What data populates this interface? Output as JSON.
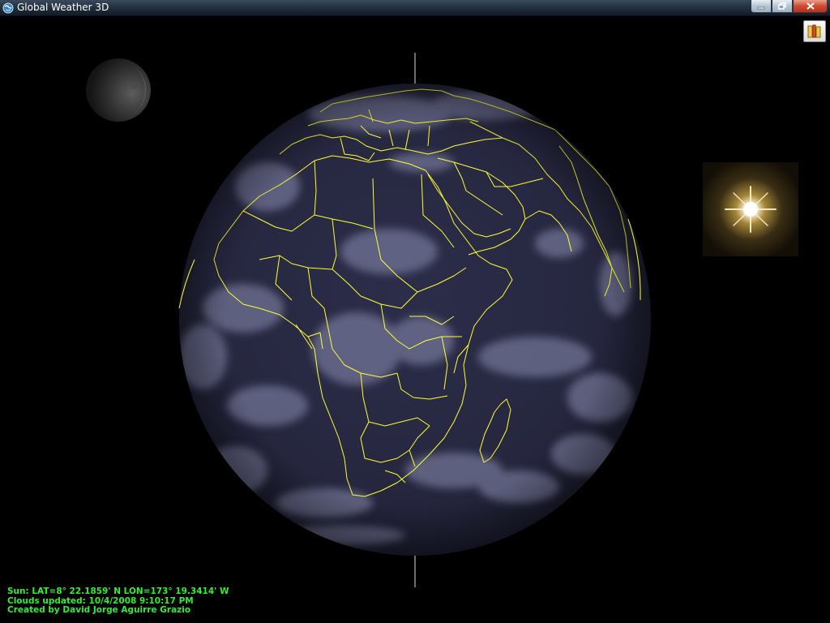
{
  "window": {
    "title": "Global Weather 3D"
  },
  "icons": {
    "app": "globe-icon",
    "minimize": "minimize-icon",
    "maximize": "restore-icon",
    "close": "close-icon",
    "tool": "settings-tool-icon",
    "moon": "moon-icon",
    "sun": "sun-icon"
  },
  "colors": {
    "background": "#000000",
    "borders": "#ffff33",
    "status_text": "#33ee33",
    "ocean": "#26273f",
    "clouds": "#8c8fb4"
  },
  "status": {
    "sun_position": "Sun: LAT=8° 22.1859' N  LON=173° 19.3414' W",
    "clouds_updated": "Clouds updated: 10/4/2008 9:10:17 PM",
    "credit": "Created by David Jorge Aguirre Grazio"
  }
}
